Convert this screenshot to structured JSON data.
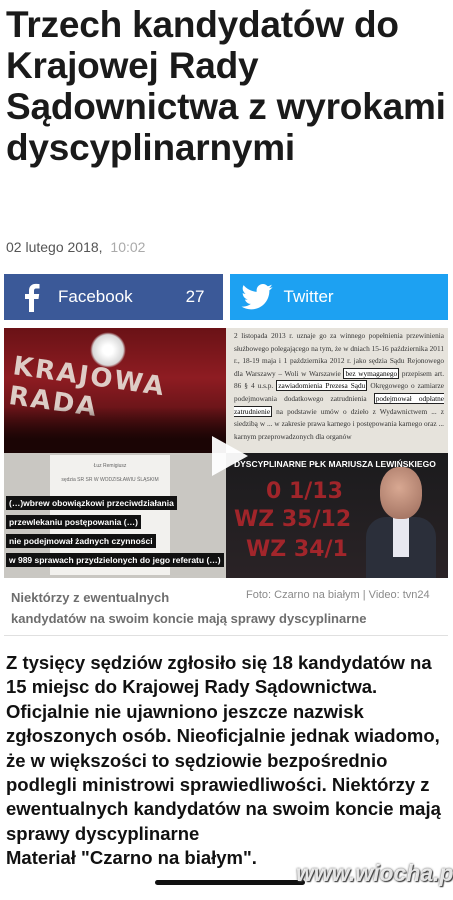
{
  "article": {
    "headline": "Trzech kandydatów do Krajowej Rady Sądownictwa z wyrokami dyscyplinarnymi",
    "date": "02 lutego 2018,",
    "time": "10:02"
  },
  "share": {
    "facebook_label": "Facebook",
    "facebook_count": "27",
    "twitter_label": "Twitter"
  },
  "media": {
    "doc_text_1": "2 listopada 2013 r. uznaje go za winnego popełnienia przewinienia służbowego polegającego na tym, że w dniach 15-16 października 2011 r., 18-19 maja i 1 października 2012 r. jako sędzia Sądu Rejonowego dla Warszawy – Woli w Warszawie",
    "doc_hl_1": "bez wymaganego",
    "doc_text_2": "przepisem art. 86 § 4 u.s.p.",
    "doc_hl_2": "zawiadomienia Prezesa Sądu",
    "doc_text_3": "Okręgowego o zamiarze podejmowania dodatkowego zatrudnienia",
    "doc_hl_3": "podejmował odpłatne zatrudnienie",
    "doc_text_4": "na podstawie umów o dzieło z Wydawnictwem ... z siedzibą w ... w zakresie prawa karnego i postępowania karnego oraz ... karnym przeprowadzonych dla organów",
    "small_doc_name": "Łuz Remigiusz",
    "small_doc_court": "sędzia SR SR W WODZISŁAWIU ŚLĄSKIM",
    "caption_lines": [
      "(…)wbrew obowiązkowi przeciwdziałania",
      "przewlekaniu postępowania (…)",
      "nie podejmował żadnych czynności",
      "w 989 sprawach przydzielonych do jego referatu (…)"
    ],
    "tv_heading": "DYSCYPLINARNE PŁK MARIUSZA LEWIŃSKIEGO",
    "tv_codes": [
      "0 1/13",
      "WZ 35/12",
      "WZ 34/1"
    ]
  },
  "caption": {
    "text_line1": "Niektórzy z ewentualnych",
    "text_line2": "kandydatów na swoim koncie mają sprawy dyscyplinarne",
    "credit": "Foto: Czarno na białym | Video: tvn24"
  },
  "body": {
    "paragraph": "Z tysięcy sędziów zgłosiło się 18 kandydatów na 15 miejsc do Krajowej Rady Sądownictwa. Oficjalnie nie ujawniono jeszcze nazwisk zgłoszonych osób. Nieoficjalnie jednak wiadomo, że w większości to sędziowie bezpośrednio podlegli ministrowi sprawiedliwości. Niektórzy z ewentualnych kandydatów na swoim koncie mają sprawy dyscyplinarne",
    "paragraph_2": "Materiał \"Czarno na białym\"."
  },
  "watermark": "www.wiocha.pl",
  "colors": {
    "facebook": "#3b5998",
    "twitter": "#1da1f2"
  }
}
